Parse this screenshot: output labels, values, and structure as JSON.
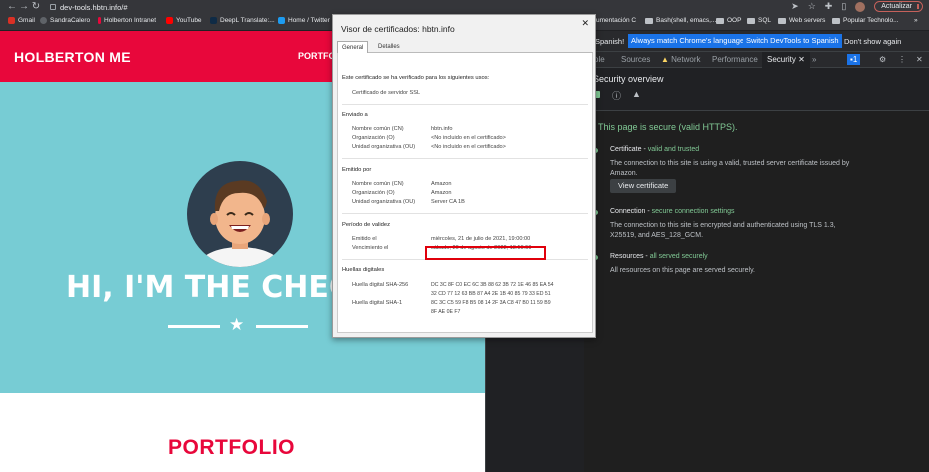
{
  "browser": {
    "url": "dev-tools.hbtn.info/#",
    "update_label": "Actualizar"
  },
  "bookmarks": {
    "items": [
      {
        "label": "Gmail",
        "color": "#d93025"
      },
      {
        "label": "SandraCalero",
        "color": "#5f6368"
      },
      {
        "label": "Holberton Intranet",
        "color": "#e8073b"
      },
      {
        "label": "YouTube",
        "color": "#ff0000"
      },
      {
        "label": "DeepL Translate:...",
        "color": "#0f2b46"
      },
      {
        "label": "Home / Twitter",
        "color": "#1d9bf0"
      }
    ],
    "right_items": [
      {
        "label": "umentación C"
      },
      {
        "label": "Bash(shell, emacs,..."
      },
      {
        "label": "OOP"
      },
      {
        "label": "SQL"
      },
      {
        "label": "Web servers"
      },
      {
        "label": "Popular Technolo..."
      }
    ],
    "more": "»"
  },
  "site": {
    "brand": "HOLBERTON ME",
    "nav_label": "PORTFO",
    "hero_title": "HI, I'M THE CHEC",
    "section_title": "PORTFOLIO"
  },
  "devtools": {
    "banner": {
      "text": "Spanish!",
      "match_btn": "Always match Chrome's language",
      "switch_btn": "Switch DevTools to Spanish",
      "dismiss": "Don't show again"
    },
    "tabs": [
      "ole",
      "Sources",
      "Network",
      "Performance",
      "Security"
    ],
    "more_tabs": "»",
    "issues_count": "1",
    "security": {
      "title": "Security overview",
      "secure_msg": "This page is secure (valid HTTPS).",
      "cert_label": "Certificate - ",
      "cert_status": "valid and trusted",
      "cert_desc": "The connection to this site is using a valid, trusted server certificate issued by Amazon.",
      "view_cert": "View certificate",
      "conn_label": "Connection - ",
      "conn_status": "secure connection settings",
      "conn_desc": "The connection to this site is encrypted and authenticated using TLS 1.3, X25519, and AES_128_GCM.",
      "res_label": "Resources - ",
      "res_status": "all served securely",
      "res_desc": "All resources on this page are served securely."
    }
  },
  "cert_dialog": {
    "title": "Visor de certificados: hbtn.info",
    "tabs": [
      "General",
      "Detalles"
    ],
    "intro": "Este certificado se ha verificado para los siguientes usos:",
    "usage": "Certificado de servidor SSL",
    "issued_to": {
      "heading": "Enviado a",
      "rows": [
        {
          "label": "Nombre común (CN)",
          "value": "hbtn.info"
        },
        {
          "label": "Organización (O)",
          "value": "<No incluido en el certificado>"
        },
        {
          "label": "Unidad organizativa (OU)",
          "value": "<No incluido en el certificado>"
        }
      ]
    },
    "issued_by": {
      "heading": "Emitido por",
      "rows": [
        {
          "label": "Nombre común (CN)",
          "value": "Amazon"
        },
        {
          "label": "Organización (O)",
          "value": "Amazon"
        },
        {
          "label": "Unidad organizativa (OU)",
          "value": "Server CA 1B"
        }
      ]
    },
    "validity": {
      "heading": "Período de validez",
      "rows": [
        {
          "label": "Emitido el",
          "value": "miércoles, 21 de julio de 2021, 19:00:00"
        },
        {
          "label": "Vencimiento el",
          "value": "sábado, 20 de agosto de 2022, 18:59:59"
        }
      ]
    },
    "fingerprints": {
      "heading": "Huellas digitales",
      "sha256_label": "Huella digital SHA-256",
      "sha256_1": "DC 3C 8F C0 EC 6C 3B 88 62 3B 72 1E 46 85 EA 54",
      "sha256_2": "32 CD 77 12 63 BB 87 A4 2E 1B 40 85 79 33 ED 51",
      "sha1_label": "Huella digital SHA-1",
      "sha1_1": "8C 3C C5 59 F8 B5 08 14 2F 3A C8 47 B0 11 59 B9",
      "sha1_2": "8F AE 0E F7"
    }
  }
}
